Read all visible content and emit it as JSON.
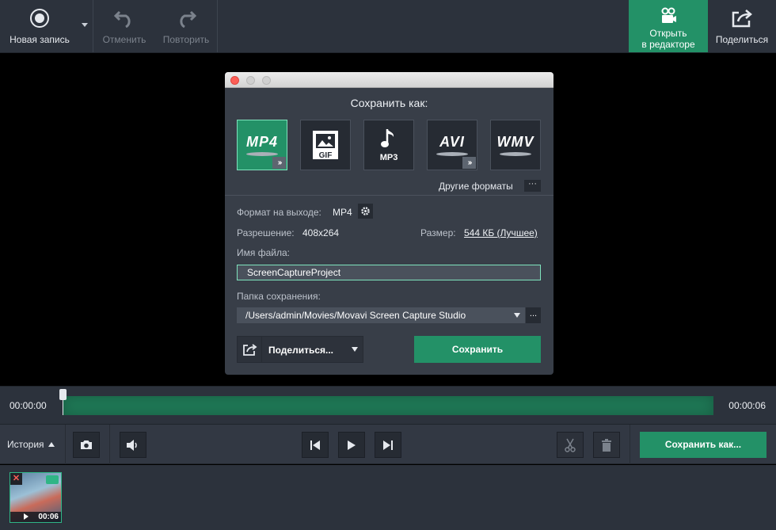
{
  "toolbar": {
    "new_recording": "Новая запись",
    "undo": "Отменить",
    "redo": "Повторить",
    "open_editor_line1": "Открыть",
    "open_editor_line2": "в редакторе",
    "share": "Поделиться"
  },
  "dialog": {
    "title": "Сохранить как:",
    "formats": [
      {
        "name": "MP4",
        "selected": true
      },
      {
        "name": "GIF",
        "selected": false
      },
      {
        "name": "MP3",
        "selected": false
      },
      {
        "name": "AVI",
        "selected": false
      },
      {
        "name": "WMV",
        "selected": false
      }
    ],
    "other_formats": "Другие форматы",
    "other_formats_btn": "···",
    "output_format_label": "Формат на выходе:",
    "output_format_value": "MP4",
    "resolution_label": "Разрешение:",
    "resolution_value": "408x264",
    "size_label": "Размер:",
    "size_value": "544 КБ (Лучшее)",
    "filename_label": "Имя файла:",
    "filename_value": "ScreenCaptureProject",
    "folder_label": "Папка сохранения:",
    "folder_value": "/Users/admin/Movies/Movavi Screen Capture Studio",
    "folder_browse": "...",
    "share_button": "Поделиться...",
    "save_button": "Сохранить"
  },
  "timeline": {
    "start_time": "00:00:00",
    "end_time": "00:00:06"
  },
  "controls": {
    "history": "История",
    "save_as": "Сохранить как..."
  },
  "history_strip": {
    "items": [
      {
        "duration": "00:06"
      }
    ]
  },
  "colors": {
    "accent_green": "#239167",
    "toolbar_bg": "#2c323c",
    "dialog_bg": "#383e48"
  }
}
